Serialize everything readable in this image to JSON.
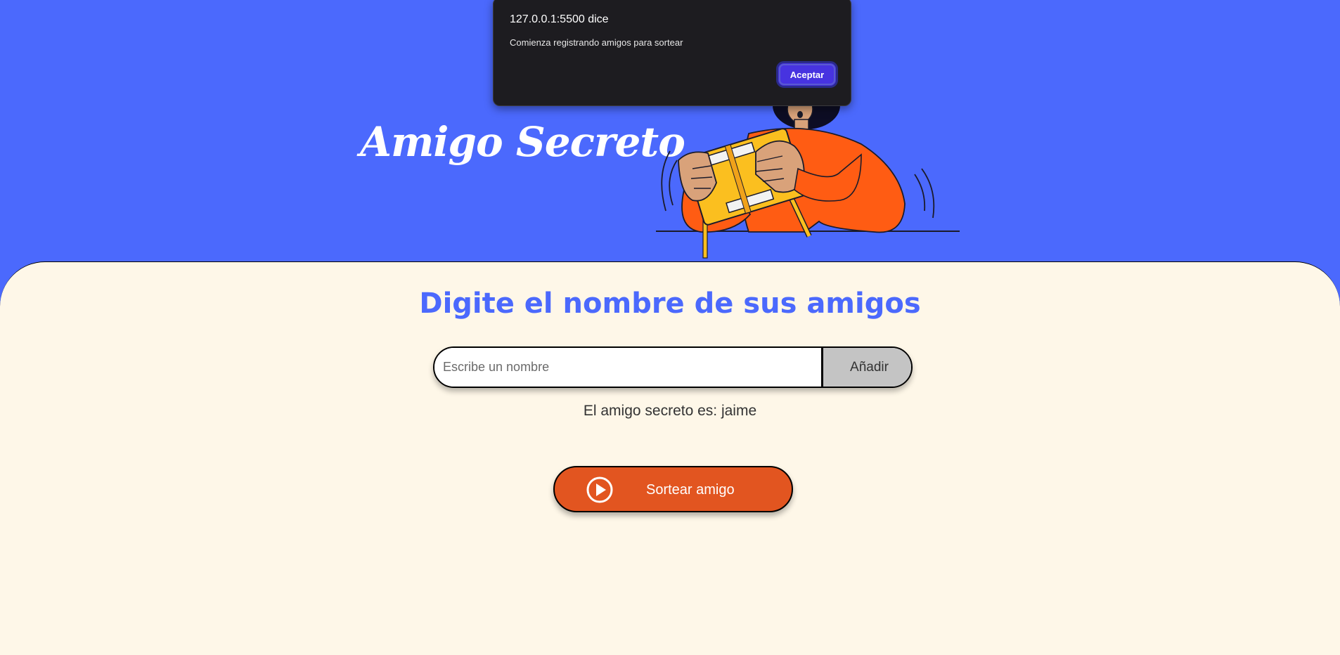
{
  "header": {
    "title": "Amigo Secreto"
  },
  "main": {
    "heading": "Digite el nombre de sus amigos",
    "name_input": {
      "value": "",
      "placeholder": "Escribe un nombre"
    },
    "add_button_label": "Añadir",
    "result_text": "El amigo secreto es: jaime",
    "draw_button_label": "Sortear amigo",
    "draw_button_icon": "play-circle-icon"
  },
  "dialog": {
    "title": "127.0.0.1:5500 dice",
    "message": "Comienza registrando amigos para sortear",
    "ok_label": "Aceptar"
  },
  "colors": {
    "header_background": "#4b69fd",
    "main_background": "#fef7e8",
    "heading_color": "#4b69fd",
    "draw_button": "#e25520",
    "add_button": "#c4c4c4",
    "dialog_background": "#1d1c20",
    "dialog_button": "#4733e0"
  }
}
